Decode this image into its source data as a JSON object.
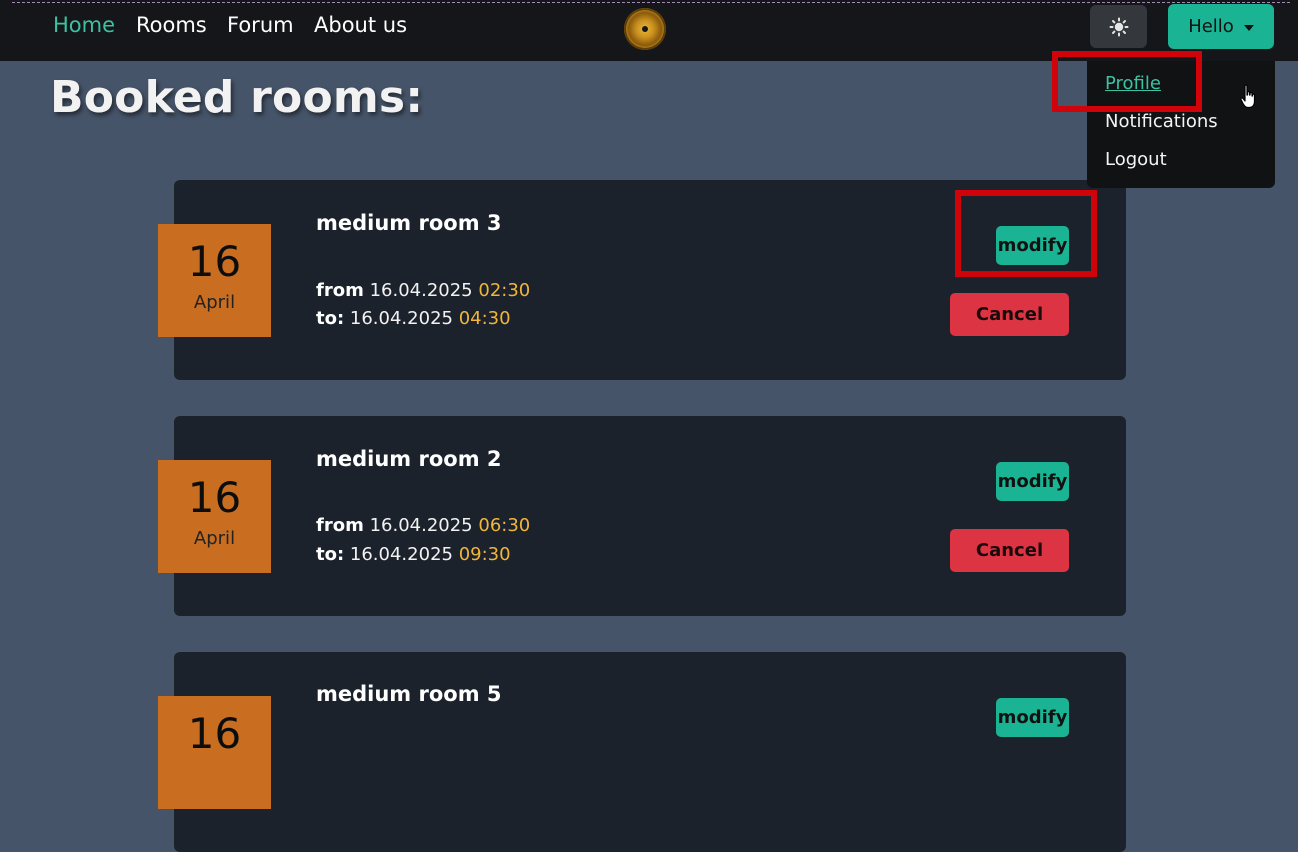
{
  "nav": {
    "links": [
      "Home",
      "Rooms",
      "Forum",
      "About us"
    ],
    "active": "Home",
    "theme_icon": "sun-icon",
    "user_menu_label": "Hello"
  },
  "user_dropdown": {
    "items": [
      "Profile",
      "Notifications",
      "Logout"
    ]
  },
  "page": {
    "title": "Booked rooms:"
  },
  "bookings": [
    {
      "room": "medium room 3",
      "day": "16",
      "month": "April",
      "from_label": "from",
      "from_date": "16.04.2025",
      "from_time": "02:30",
      "to_label": "to:",
      "to_date": "16.04.2025",
      "to_time": "04:30",
      "modify_label": "modify",
      "cancel_label": "Cancel"
    },
    {
      "room": "medium room 2",
      "day": "16",
      "month": "April",
      "from_label": "from",
      "from_date": "16.04.2025",
      "from_time": "06:30",
      "to_label": "to:",
      "to_date": "16.04.2025",
      "to_time": "09:30",
      "modify_label": "modify",
      "cancel_label": "Cancel"
    },
    {
      "room": "medium room 5",
      "day": "16",
      "month": "",
      "modify_label": "modify"
    }
  ],
  "colors": {
    "accent": "#1ab394",
    "danger": "#dd3444",
    "date_badge": "#c96e20",
    "time_highlight": "#f1b53b",
    "highlight_box": "#d0020a"
  }
}
